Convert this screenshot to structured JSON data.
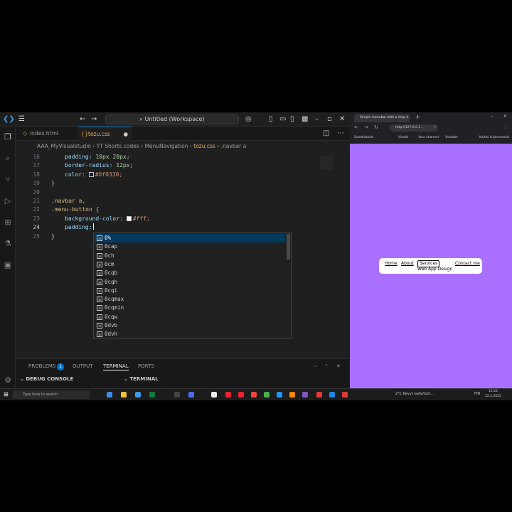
{
  "vscode": {
    "title": "Untitled (Workspace)",
    "tabs": [
      {
        "label": "index.html",
        "active": false
      },
      {
        "label": "tozu.css",
        "active": true
      }
    ],
    "breadcrumb": [
      "AAA_MyVisualstudio",
      "YT Shorts codes",
      "MenuNavigation",
      "tozu.css",
      ".navbar a"
    ],
    "lines": [
      {
        "num": "16"
      },
      {
        "num": "17"
      },
      {
        "num": "18"
      },
      {
        "num": "19"
      },
      {
        "num": "20"
      },
      {
        "num": "21"
      },
      {
        "num": "22"
      },
      {
        "num": "23"
      },
      {
        "num": "24"
      },
      {
        "num": "25"
      }
    ],
    "code": {
      "l16p": "padding:",
      "l16v": "10px 20px;",
      "l17p": "border-radius:",
      "l17v": "12px;",
      "l18p": "color:",
      "l18v": "#0f0330;",
      "l19": "}",
      "l21": ".navbar a,",
      "l22": ".menu-button {",
      "l23p": "background-color:",
      "l23v": "#fff;",
      "l24p": "padding:",
      "l25": "}"
    },
    "suggestions": [
      "0%",
      "0cap",
      "0ch",
      "0cm",
      "0cqb",
      "0cqh",
      "0cqi",
      "0cqmax",
      "0cqmin",
      "0cqw",
      "0dvb",
      "0dvh"
    ],
    "panel": {
      "problems": "PROBLEMS",
      "problems_count": "1",
      "output": "OUTPUT",
      "terminal": "TERMINAL",
      "ports": "PORTS",
      "debug_console": "DEBUG CONSOLE",
      "terminal_section": "TERMINAL"
    },
    "colors": {
      "accent": "#0078d4",
      "background": "#1f1f1f"
    }
  },
  "browser": {
    "tab_title": "Simple menubar with a drop d...",
    "address": "http://127.0.0.1...",
    "bookmarks": [
      "Sovelluksiet",
      "Viestit",
      "Your channel",
      "Youtube",
      "Kaikki kirjanmerkit"
    ],
    "nav": [
      "Home",
      "About",
      "Services",
      "Contact me"
    ],
    "sub": "Web App Design",
    "colors": {
      "background": "#a970ff"
    }
  },
  "taskbar": {
    "search": "Type here to search",
    "weather": "2°C Kevyt sade/lum...",
    "lang": "FIN",
    "time": "15:22",
    "date": "22.2.2025"
  }
}
